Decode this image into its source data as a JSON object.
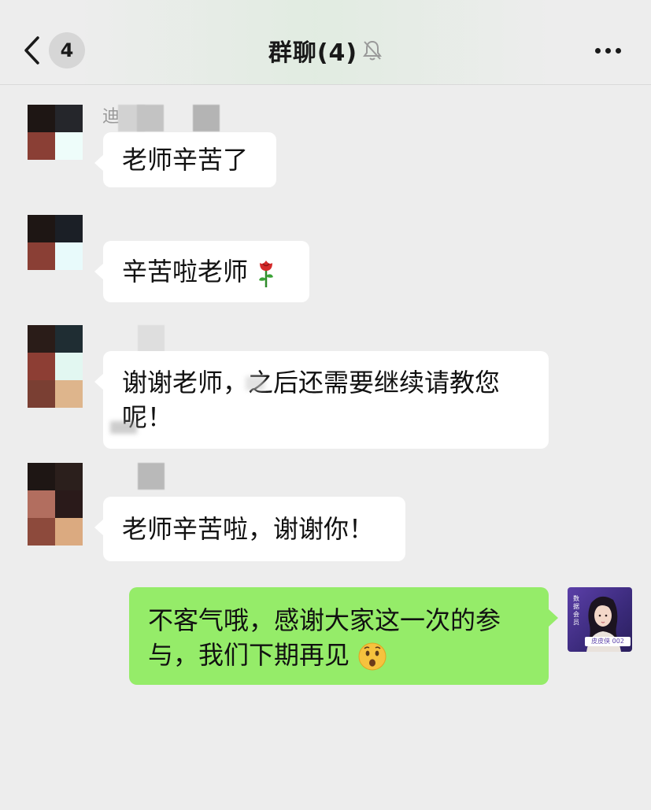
{
  "header": {
    "back_count": "4",
    "title": "群聊(4)",
    "muted_icon": "bell-slash-icon",
    "more_icon": "more-dots-icon"
  },
  "messages": [
    {
      "sender": "other",
      "name_visible_fragment": "迪",
      "text": "老师辛苦了"
    },
    {
      "sender": "other",
      "text": "辛苦啦老师",
      "emoji": "rose"
    },
    {
      "sender": "other",
      "line1": "谢谢老师，之后还需要继续请教您",
      "line2": "呢！"
    },
    {
      "sender": "other",
      "text": "老师辛苦啦，谢谢你！"
    },
    {
      "sender": "me",
      "line1": "不客气哦，感谢大家这一次的参",
      "line2": "与，我们下期再见",
      "emoji": "hushed-face"
    }
  ],
  "my_avatar": {
    "badge_line1": "数据",
    "badge_line2": "会员",
    "caption": "皮皮侠 002"
  },
  "colors": {
    "background": "#ededed",
    "bubble_other": "#ffffff",
    "bubble_me": "#95ec69"
  }
}
